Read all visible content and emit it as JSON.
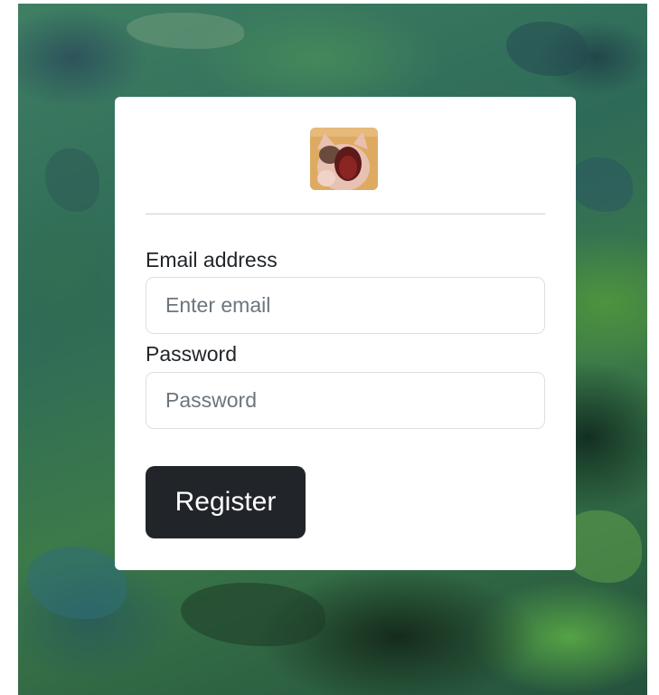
{
  "form": {
    "avatar_icon": "screaming-cat-icon",
    "email": {
      "label": "Email address",
      "placeholder": "Enter email",
      "value": ""
    },
    "password": {
      "label": "Password",
      "placeholder": "Password",
      "value": ""
    },
    "submit_label": "Register"
  },
  "colors": {
    "button_bg": "#212529",
    "card_bg": "#ffffff",
    "text": "#212529",
    "placeholder": "#6c757d"
  }
}
